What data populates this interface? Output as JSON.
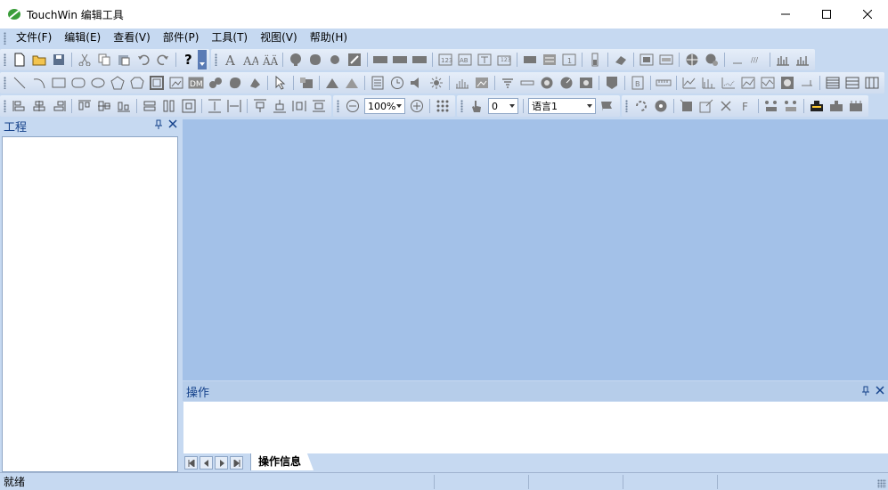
{
  "window": {
    "title": "TouchWin 编辑工具",
    "controls": [
      "minimize-icon",
      "maximize-icon",
      "close-icon"
    ]
  },
  "menu": {
    "items": [
      {
        "label": "文件(F)"
      },
      {
        "label": "编辑(E)"
      },
      {
        "label": "查看(V)"
      },
      {
        "label": "部件(P)"
      },
      {
        "label": "工具(T)"
      },
      {
        "label": "视图(V)"
      },
      {
        "label": "帮助(H)"
      }
    ]
  },
  "toolbar": {
    "zoom_value": "100%",
    "number_value": "0",
    "language_value": "语言1"
  },
  "left_panel": {
    "title": "工程"
  },
  "output_panel": {
    "title": "操作",
    "active_tab": "操作信息"
  },
  "status": {
    "text": "就绪"
  },
  "colors": {
    "chrome": "#c6d9f1",
    "workspace": "#a3c1e8",
    "panel_title": "#15428b"
  }
}
